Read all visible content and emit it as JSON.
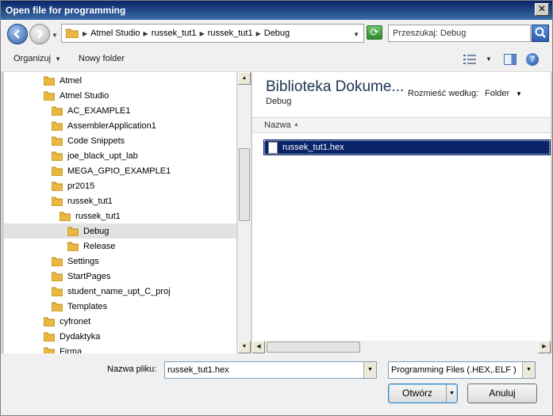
{
  "window": {
    "title": "Open file for programming"
  },
  "address": {
    "crumbs": [
      "Atmel Studio",
      "russek_tut1",
      "russek_tut1",
      "Debug"
    ],
    "search_placeholder": "Przeszukaj: Debug"
  },
  "toolbar": {
    "organize_label": "Organizuj",
    "new_folder_label": "Nowy folder"
  },
  "nav_tree": [
    {
      "label": "Atmel",
      "level": 0
    },
    {
      "label": "Atmel Studio",
      "level": 0
    },
    {
      "label": "AC_EXAMPLE1",
      "level": 1
    },
    {
      "label": "AssemblerApplication1",
      "level": 1
    },
    {
      "label": "Code Snippets",
      "level": 1
    },
    {
      "label": "joe_black_upt_lab",
      "level": 1
    },
    {
      "label": "MEGA_GPIO_EXAMPLE1",
      "level": 1
    },
    {
      "label": "pr2015",
      "level": 1
    },
    {
      "label": "russek_tut1",
      "level": 1
    },
    {
      "label": "russek_tut1",
      "level": 2
    },
    {
      "label": "Debug",
      "level": 3,
      "selected": true
    },
    {
      "label": "Release",
      "level": 3
    },
    {
      "label": "Settings",
      "level": 1
    },
    {
      "label": "StartPages",
      "level": 1
    },
    {
      "label": "student_name_upt_C_proj",
      "level": 1
    },
    {
      "label": "Templates",
      "level": 1
    },
    {
      "label": "cyfronet",
      "level": 0
    },
    {
      "label": "Dydaktyka",
      "level": 0
    },
    {
      "label": "Firma",
      "level": 0
    }
  ],
  "main": {
    "library_title": "Biblioteka Dokume...",
    "library_subtitle": "Debug",
    "arrange_label": "Rozmieść według:",
    "arrange_value": "Folder",
    "column_name": "Nazwa",
    "files": [
      {
        "name": "russek_tut1.hex",
        "selected": true
      }
    ]
  },
  "bottom": {
    "filename_label": "Nazwa pliku:",
    "filename_value": "russek_tut1.hex",
    "filetype_value": "Programming Files (.HEX,.ELF )",
    "open_label": "Otwórz",
    "cancel_label": "Anuluj"
  },
  "colors": {
    "title_bar": "#0a246a",
    "selection": "#0a246a",
    "folder": "#e8b840"
  }
}
